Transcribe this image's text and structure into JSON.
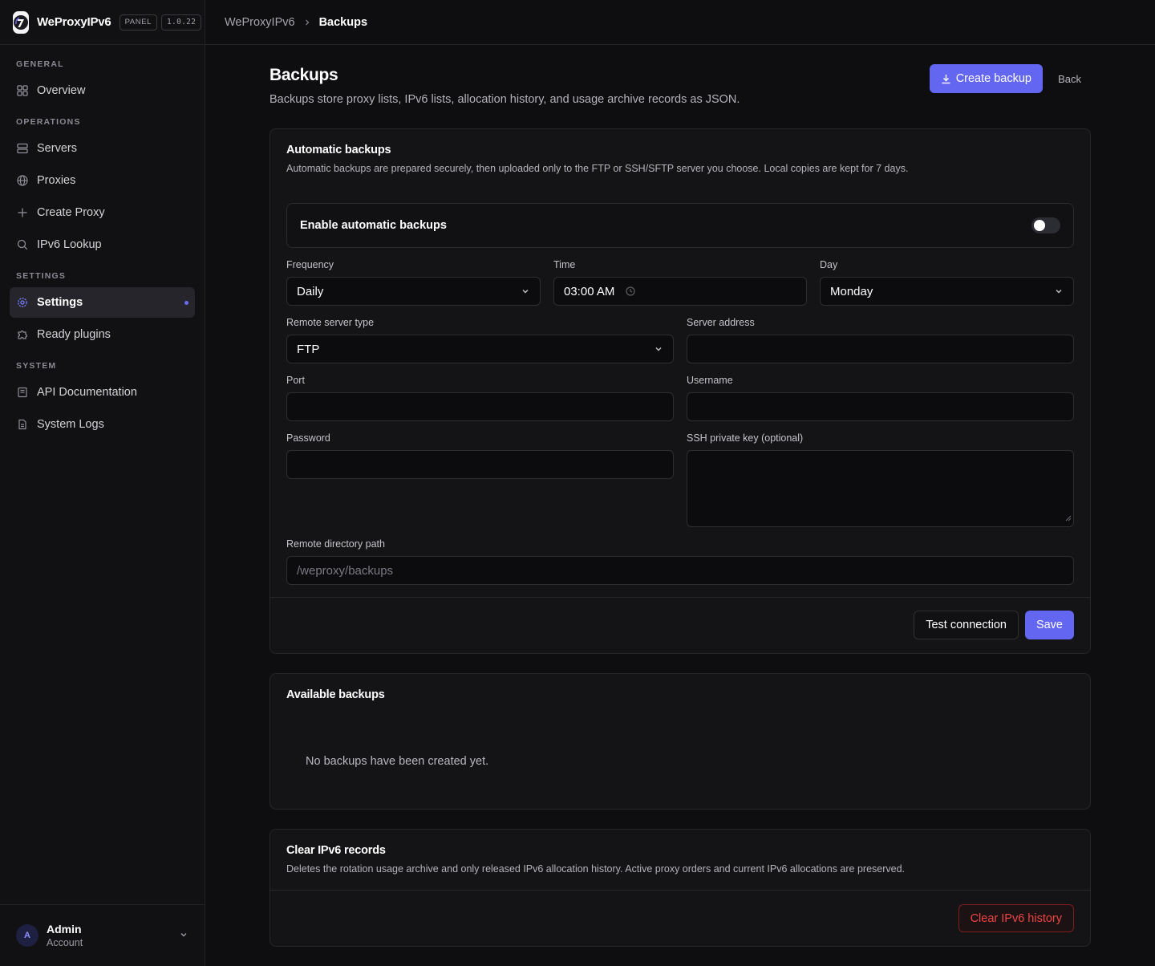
{
  "brand": {
    "name": "WeProxyIPv6",
    "badge": "PANEL",
    "version": "1.0.22"
  },
  "sidebar": {
    "groups": [
      {
        "heading": "GENERAL",
        "items": [
          {
            "label": "Overview",
            "icon": "grid-icon"
          }
        ]
      },
      {
        "heading": "OPERATIONS",
        "items": [
          {
            "label": "Servers",
            "icon": "server-icon"
          },
          {
            "label": "Proxies",
            "icon": "globe-icon"
          },
          {
            "label": "Create Proxy",
            "icon": "plus-icon"
          },
          {
            "label": "IPv6 Lookup",
            "icon": "search-icon"
          }
        ]
      },
      {
        "heading": "SETTINGS",
        "items": [
          {
            "label": "Settings",
            "icon": "gear-icon",
            "active": true
          },
          {
            "label": "Ready plugins",
            "icon": "puzzle-icon"
          }
        ]
      },
      {
        "heading": "SYSTEM",
        "items": [
          {
            "label": "API Documentation",
            "icon": "book-icon"
          },
          {
            "label": "System Logs",
            "icon": "file-icon"
          }
        ]
      }
    ],
    "user": {
      "initial": "A",
      "name": "Admin",
      "role": "Account"
    }
  },
  "breadcrumb": {
    "root": "WeProxyIPv6",
    "current": "Backups"
  },
  "page": {
    "title": "Backups",
    "subtitle": "Backups store proxy lists, IPv6 lists, allocation history, and usage archive records as JSON.",
    "create_label": "Create backup",
    "back_label": "Back"
  },
  "auto": {
    "title": "Automatic backups",
    "description": "Automatic backups are prepared securely, then uploaded only to the FTP or SSH/SFTP server you choose. Local copies are kept for 7 days.",
    "toggle_label": "Enable automatic backups",
    "enabled": false,
    "frequency": {
      "label": "Frequency",
      "value": "Daily"
    },
    "time": {
      "label": "Time",
      "value": "03:00 AM"
    },
    "day": {
      "label": "Day",
      "value": "Monday"
    },
    "server_type": {
      "label": "Remote server type",
      "value": "FTP"
    },
    "server_address": {
      "label": "Server address",
      "value": ""
    },
    "port": {
      "label": "Port",
      "value": ""
    },
    "username": {
      "label": "Username",
      "value": ""
    },
    "password": {
      "label": "Password",
      "value": ""
    },
    "ssh_key": {
      "label": "SSH private key (optional)",
      "value": ""
    },
    "remote_path": {
      "label": "Remote directory path",
      "placeholder": "/weproxy/backups"
    },
    "test_label": "Test connection",
    "save_label": "Save"
  },
  "available": {
    "title": "Available backups",
    "empty": "No backups have been created yet."
  },
  "clear": {
    "title": "Clear IPv6 records",
    "description": "Deletes the rotation usage archive and only released IPv6 allocation history. Active proxy orders and current IPv6 allocations are preserved.",
    "button_label": "Clear IPv6 history"
  },
  "colors": {
    "accent": "#6366f1",
    "danger": "#ef4444",
    "background": "#0e0e10"
  }
}
